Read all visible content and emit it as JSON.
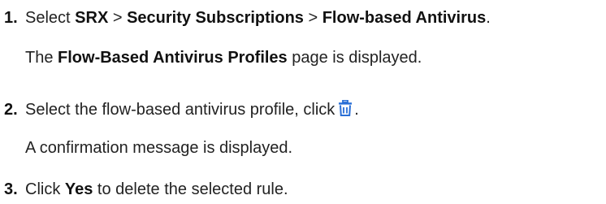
{
  "steps": [
    {
      "number": "1.",
      "parts": {
        "t1": "Select ",
        "b1": "SRX",
        "t2": " > ",
        "b2": "Security Subscriptions",
        "t3": " > ",
        "b3": "Flow-based Antivirus",
        "t4": "."
      },
      "sub": {
        "t1": "The ",
        "b1": "Flow-Based Antivirus Profiles",
        "t2": " page is displayed."
      }
    },
    {
      "number": "2.",
      "parts": {
        "t1": "Select the flow-based antivirus profile, click",
        "t2": "."
      },
      "icon": "trash-icon",
      "sub": {
        "t1": "A confirmation message is displayed."
      }
    },
    {
      "number": "3.",
      "parts": {
        "t1": "Click ",
        "b1": "Yes",
        "t2": " to delete the selected rule."
      }
    }
  ],
  "colors": {
    "text": "#222222",
    "icon": "#2a6fd6"
  }
}
